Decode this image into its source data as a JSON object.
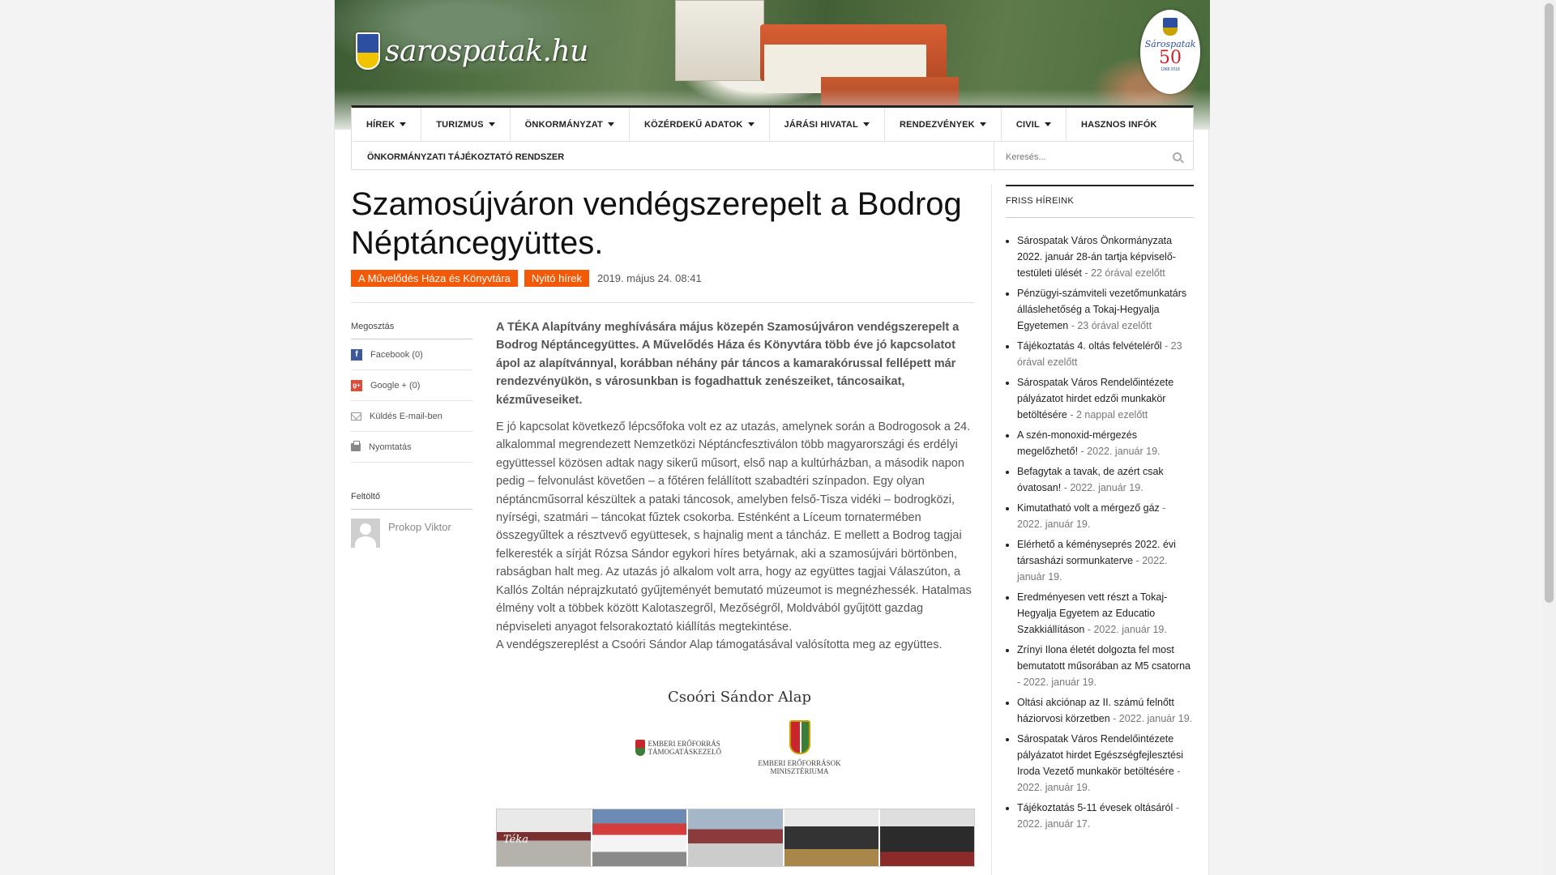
{
  "header": {
    "logo_text": "sarospatak.hu",
    "badge_name": "Sárospatak",
    "badge_number": "50",
    "badge_years": "1968   2018"
  },
  "nav": {
    "row1": [
      "HÍREK",
      "TURIZMUS",
      "ÖNKORMÁNYZAT",
      "KÖZÉRDEKŰ ADATOK",
      "JÁRÁSI HIVATAL",
      "RENDEZVÉNYEK",
      "CIVIL",
      "HASZNOS INFÓK"
    ],
    "row1_has_caret": [
      true,
      true,
      true,
      true,
      true,
      true,
      true,
      false
    ],
    "row2": "ÖNKORMÁNYZATI TÁJÉKOZTATÓ RENDSZER",
    "search_placeholder": "Keresés..."
  },
  "article": {
    "title": "Szamosújváron vendégszerepelt a Bodrog Néptáncegyüttes.",
    "tags": [
      "A Művelődés Háza és Könyvtára",
      "Nyitó hírek"
    ],
    "date": "2019. május 24. 08:41",
    "lead": "A TÉKA Alapítvány meghívására május közepén Szamosújváron vendégszerepelt a Bodrog Néptáncegyüttes. A Művelődés Háza és Könyvtára több éve jó kapcsolatot ápol az alapítvánnyal, korábban néhány pár táncos a kamarakórussal fellépett már rendezvényükön, s városunkban is fogadhattuk zenészeiket, táncosaikat, kézműveseiket.",
    "body": "E jó kapcsolat következő lépcsőfoka volt ez az utazás, amelynek során  a Bodrogosok a 24. alkalommal megrendezett Nemzetközi Néptáncfesztiválon több magyarországi és erdélyi együttessel közösen adtak nagy sikerű műsort, első nap a kultúrházban, a második napon pedig – felvonulást követően – a főtéren felállított szabadtéri színpadon. Egy olyan néptáncműsorral készültek a pataki táncosok, amelyben felső-Tisza vidéki – bodrogközi, nyírségi, szatmári – táncokat fűztek csokorba. Esténként a Líceum tornatermében összegyűltek a résztvevő együttesek, s hajnalig ment a táncház. E mellett a Bodrog tagjai felkeresték a sírját Rózsa Sándor egykori híres betyárnak, aki a szamosújvári börtönben, rabságban halt meg. Az utazás jó alkalom volt arra, hogy az együttes tagjai Válaszúton, a Kallós Zoltán néprajzkutató gyűjteményét bemutató múzeumot is megnézhessék. Hatalmas élmény volt a többek között Kalotaszegről, Mezőségről, Moldvából gyűjtött gazdag népviseleti anyagot felsorakoztató kiállítás megtekintése.",
    "closing": "A vendégszereplést a Csoóri Sándor Alap támogatásával valósította meg az együttes.",
    "sponsor_title": "Csoóri Sándor Alap",
    "sponsor_left": "EMBERI ERŐFORRÁS TÁMOGATÁSKEZELŐ",
    "sponsor_right": "EMBERI ERŐFORRÁSOK MINISZTÉRIUMA"
  },
  "share": {
    "heading": "Megosztás",
    "items": [
      "Facebook (0)",
      "Google + (0)",
      "Küldés E-mail-ben",
      "Nyomtatás"
    ],
    "icons": [
      "facebook-icon",
      "google-plus-icon",
      "mail-icon",
      "print-icon"
    ],
    "uploader_heading": "Feltöltő",
    "uploader_name": "Prokop Viktor"
  },
  "sidebar": {
    "heading": "FRISS HÍREINK",
    "news": [
      {
        "title": "Sárospatak Város Önkormányzata 2022. január 28-án tartja képviselő-testületi ülését",
        "ago": " - 22 órával ezelőtt"
      },
      {
        "title": "Pénzügyi-számviteli vezetőmunkatárs álláslehetőség a Tokaj-Hegyalja Egyetemen",
        "ago": " - 23 órával ezelőtt"
      },
      {
        "title": "Tájékoztatás 4. oltás felvételéről",
        "ago": " - 23 órával ezelőtt"
      },
      {
        "title": "Sárospatak Város Rendelőintézete pályázatot hirdet edzői munkakör betöltésére",
        "ago": " - 2 nappal ezelőtt"
      },
      {
        "title": "A szén-monoxid-mérgezés megelőzhető!",
        "ago": " - 2022. január 19."
      },
      {
        "title": "Befagytak a tavak, de azért csak óvatosan!",
        "ago": " - 2022. január 19."
      },
      {
        "title": "Kimutatható volt a mérgező gáz",
        "ago": " - 2022. január 19."
      },
      {
        "title": "Elérhető a kéményseprés 2022. évi társasházi sormunkaterve",
        "ago": " - 2022. január 19."
      },
      {
        "title": "Eredményesen vett részt a Tokaj-Hegyalja Egyetem az Educatio Szakkiállításon",
        "ago": " - 2022. január 19."
      },
      {
        "title": "Zrínyi Ilona életét dolgozta fel most bemutatott műsorában az M5 csatorna",
        "ago": " - 2022. január 19."
      },
      {
        "title": "Oltási akciónap az II. számú felnőtt háziorvosi körzetben",
        "ago": " - 2022. január 19."
      },
      {
        "title": "Sárospatak Város Rendelőintézete pályázatot hirdet Egészségfejlesztési Iroda Vezető munkakör betöltésére",
        "ago": " - 2022. január 19."
      },
      {
        "title": "Tájékoztatás 5-11 évesek oltásáról",
        "ago": " - 2022. január 17."
      }
    ]
  }
}
